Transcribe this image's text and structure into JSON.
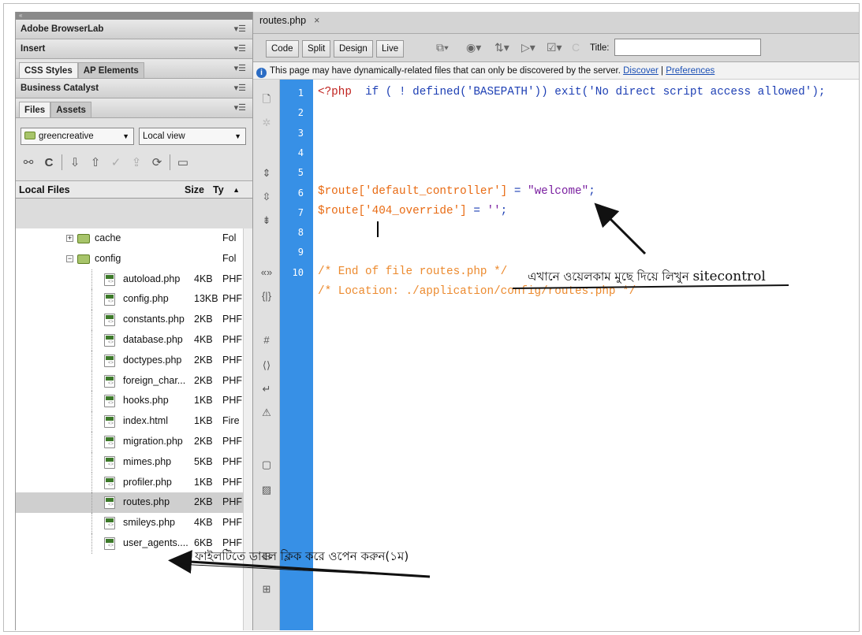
{
  "panel": {
    "collapse": "«",
    "adobe_browserlab": "Adobe BrowserLab",
    "insert": "Insert",
    "css_styles_tab": "CSS Styles",
    "ap_elements_tab": "AP Elements",
    "business_catalyst": "Business Catalyst",
    "files_tab": "Files",
    "assets_tab": "Assets",
    "menu_glyph": "▾☰",
    "site_select": "greencreative",
    "view_select": "Local view",
    "col_local_files": "Local Files",
    "col_size": "Size",
    "col_type": "Ty"
  },
  "tree": [
    {
      "name": "cache",
      "size": "",
      "type": "Fol",
      "kind": "folder"
    },
    {
      "name": "config",
      "size": "",
      "type": "Fol",
      "kind": "folder"
    },
    {
      "name": "autoload.php",
      "size": "4KB",
      "type": "PHF",
      "kind": "file"
    },
    {
      "name": "config.php",
      "size": "13KB",
      "type": "PHF",
      "kind": "file"
    },
    {
      "name": "constants.php",
      "size": "2KB",
      "type": "PHF",
      "kind": "file"
    },
    {
      "name": "database.php",
      "size": "4KB",
      "type": "PHF",
      "kind": "file"
    },
    {
      "name": "doctypes.php",
      "size": "2KB",
      "type": "PHF",
      "kind": "file"
    },
    {
      "name": "foreign_char...",
      "size": "2KB",
      "type": "PHF",
      "kind": "file"
    },
    {
      "name": "hooks.php",
      "size": "1KB",
      "type": "PHF",
      "kind": "file"
    },
    {
      "name": "index.html",
      "size": "1KB",
      "type": "Fire",
      "kind": "file"
    },
    {
      "name": "migration.php",
      "size": "2KB",
      "type": "PHF",
      "kind": "file"
    },
    {
      "name": "mimes.php",
      "size": "5KB",
      "type": "PHF",
      "kind": "file"
    },
    {
      "name": "profiler.php",
      "size": "1KB",
      "type": "PHF",
      "kind": "file"
    },
    {
      "name": "routes.php",
      "size": "2KB",
      "type": "PHF",
      "kind": "file"
    },
    {
      "name": "smileys.php",
      "size": "4KB",
      "type": "PHF",
      "kind": "file"
    },
    {
      "name": "user_agents....",
      "size": "6KB",
      "type": "PHF",
      "kind": "file"
    }
  ],
  "editor": {
    "doc_tab": "routes.php",
    "close": "×",
    "btn_code": "Code",
    "btn_split": "Split",
    "btn_design": "Design",
    "btn_live": "Live",
    "title_label": "Title:",
    "info_text": "This page may have dynamically-related files that can only be discovered by the server.",
    "info_discover": "Discover",
    "info_sep": "|",
    "info_preferences": "Preferences",
    "line_numbers": [
      "1",
      "2",
      "3",
      "4",
      "5",
      "6",
      "7",
      "8",
      "9",
      "10"
    ],
    "code": {
      "l1_open": "<?php",
      "l1_rest": "  if ( ! defined('BASEPATH')) exit('No direct script access allowed');",
      "l5_var": "$route['default_controller']",
      "l5_eq": " = ",
      "l5_str": "\"welcome\"",
      "l5_end": ";",
      "l6_var": "$route['404_override']",
      "l6_eq": " = ",
      "l6_str": "''",
      "l6_end": ";",
      "l9": "/* End of file routes.php */",
      "l10": "/* Location: ./application/config/routes.php */"
    }
  },
  "annotations": {
    "edit_note_bn": "এখানে ওয়েলকাম মুছে দিয়ে লিখুন",
    "edit_note_en": "sitecontrol",
    "open_note": "এ ফাইলটিতে ডাবল ক্লিক করে ওপেন করুন(১ম)"
  }
}
